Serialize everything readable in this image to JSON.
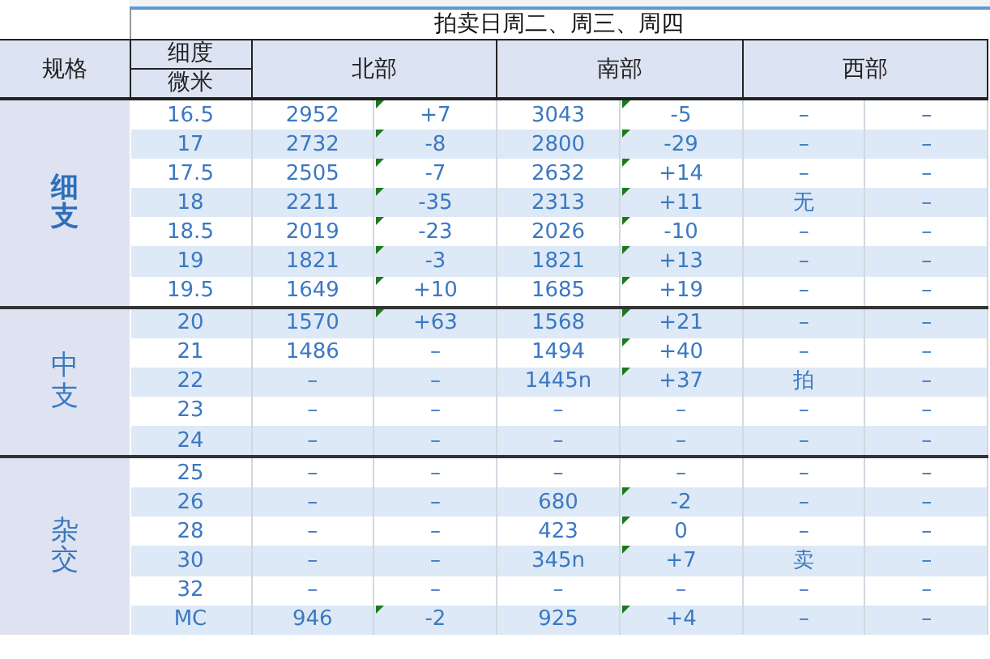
{
  "title": "拍卖日周二、周三、周四",
  "header": {
    "spec": "规格",
    "fineness": "细度",
    "unit": "微米",
    "regions": [
      "北部",
      "南部",
      "西部"
    ]
  },
  "groups": [
    {
      "label": "细支",
      "emphasized": true,
      "rows": [
        {
          "size": "16.5",
          "north": {
            "price": "2952",
            "change": "+7",
            "flag": true
          },
          "south": {
            "price": "3043",
            "change": "-5",
            "flag": true
          },
          "west": [
            "–",
            "–"
          ]
        },
        {
          "size": "17",
          "north": {
            "price": "2732",
            "change": "-8",
            "flag": true
          },
          "south": {
            "price": "2800",
            "change": "-29",
            "flag": true
          },
          "west": [
            "–",
            "–"
          ]
        },
        {
          "size": "17.5",
          "north": {
            "price": "2505",
            "change": "-7",
            "flag": true
          },
          "south": {
            "price": "2632",
            "change": "+14",
            "flag": true
          },
          "west": [
            "–",
            "–"
          ]
        },
        {
          "size": "18",
          "north": {
            "price": "2211",
            "change": "-35",
            "flag": true
          },
          "south": {
            "price": "2313",
            "change": "+11",
            "flag": true
          },
          "west": [
            "无",
            "–"
          ]
        },
        {
          "size": "18.5",
          "north": {
            "price": "2019",
            "change": "-23",
            "flag": true
          },
          "south": {
            "price": "2026",
            "change": "-10",
            "flag": true
          },
          "west": [
            "–",
            "–"
          ]
        },
        {
          "size": "19",
          "north": {
            "price": "1821",
            "change": "-3",
            "flag": true
          },
          "south": {
            "price": "1821",
            "change": "+13",
            "flag": true
          },
          "west": [
            "–",
            "–"
          ]
        },
        {
          "size": "19.5",
          "north": {
            "price": "1649",
            "change": "+10",
            "flag": true
          },
          "south": {
            "price": "1685",
            "change": "+19",
            "flag": true
          },
          "west": [
            "–",
            "–"
          ]
        }
      ]
    },
    {
      "label": "中支",
      "emphasized": false,
      "rows": [
        {
          "size": "20",
          "north": {
            "price": "1570",
            "change": "+63",
            "flag": true
          },
          "south": {
            "price": "1568",
            "change": "+21",
            "flag": true
          },
          "west": [
            "–",
            "–"
          ]
        },
        {
          "size": "21",
          "north": {
            "price": "1486",
            "change": "–",
            "flag": false
          },
          "south": {
            "price": "1494",
            "change": "+40",
            "flag": true
          },
          "west": [
            "–",
            "–"
          ]
        },
        {
          "size": "22",
          "north": {
            "price": "–",
            "change": "–",
            "flag": false
          },
          "south": {
            "price": "1445n",
            "change": "+37",
            "flag": true
          },
          "west": [
            "拍",
            "–"
          ]
        },
        {
          "size": "23",
          "north": {
            "price": "–",
            "change": "–",
            "flag": false
          },
          "south": {
            "price": "–",
            "change": "–",
            "flag": false
          },
          "west": [
            "–",
            "–"
          ]
        },
        {
          "size": "24",
          "north": {
            "price": "–",
            "change": "–",
            "flag": false
          },
          "south": {
            "price": "–",
            "change": "–",
            "flag": false
          },
          "west": [
            "–",
            "–"
          ]
        }
      ]
    },
    {
      "label": "杂交",
      "emphasized": false,
      "rows": [
        {
          "size": "25",
          "north": {
            "price": "–",
            "change": "–",
            "flag": false
          },
          "south": {
            "price": "–",
            "change": "–",
            "flag": false
          },
          "west": [
            "–",
            "–"
          ]
        },
        {
          "size": "26",
          "north": {
            "price": "–",
            "change": "–",
            "flag": false
          },
          "south": {
            "price": "680",
            "change": "-2",
            "flag": true
          },
          "west": [
            "–",
            "–"
          ]
        },
        {
          "size": "28",
          "north": {
            "price": "–",
            "change": "–",
            "flag": false
          },
          "south": {
            "price": "423",
            "change": "0",
            "flag": true
          },
          "west": [
            "–",
            "–"
          ]
        },
        {
          "size": "30",
          "north": {
            "price": "–",
            "change": "–",
            "flag": false
          },
          "south": {
            "price": "345n",
            "change": "+7",
            "flag": true
          },
          "west": [
            "卖",
            "–"
          ]
        },
        {
          "size": "32",
          "north": {
            "price": "–",
            "change": "–",
            "flag": false
          },
          "south": {
            "price": "–",
            "change": "–",
            "flag": false
          },
          "west": [
            "–",
            "–"
          ]
        },
        {
          "size": "MC",
          "north": {
            "price": "946",
            "change": "-2",
            "flag": true
          },
          "south": {
            "price": "925",
            "change": "+4",
            "flag": true
          },
          "west": [
            "–",
            "–"
          ]
        }
      ]
    }
  ]
}
